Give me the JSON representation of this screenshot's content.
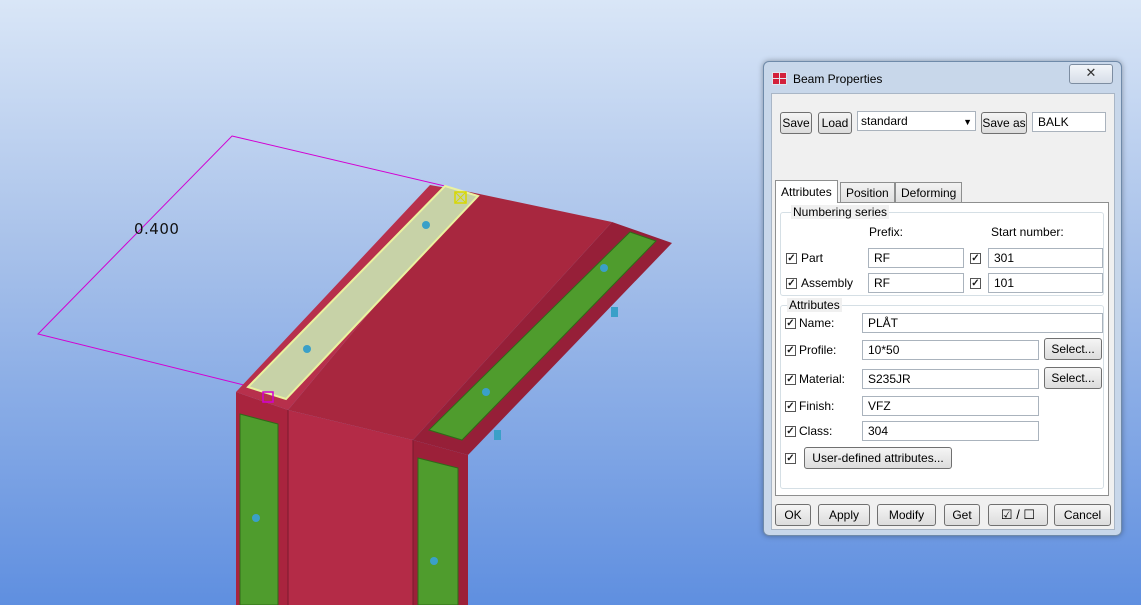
{
  "viewport": {
    "dimension_value": "0.400",
    "colors": {
      "beam": "#a52540",
      "plate": "#4e9a2c",
      "selected_plate": "#c8d6a2",
      "dimension_line": "#d200d2",
      "bolt": "#3aa0c8"
    }
  },
  "dialog": {
    "title": "Beam Properties",
    "close_icon": "close-icon",
    "toolbar": {
      "save_label": "Save",
      "load_label": "Load",
      "preset_value": "standard",
      "save_as_label": "Save as",
      "save_as_value": "BALK"
    },
    "tabs": [
      {
        "label": "Attributes",
        "active": true
      },
      {
        "label": "Position",
        "active": false
      },
      {
        "label": "Deforming",
        "active": false
      }
    ],
    "numbering": {
      "title": "Numbering series",
      "prefix_header": "Prefix:",
      "start_header": "Start number:",
      "rows": [
        {
          "label": "Part",
          "checked": true,
          "prefix": "RF",
          "start_checked": true,
          "start": "301"
        },
        {
          "label": "Assembly",
          "checked": true,
          "prefix": "RF",
          "start_checked": true,
          "start": "101"
        }
      ]
    },
    "attributes": {
      "title": "Attributes",
      "name": {
        "label": "Name:",
        "value": "PLÅT",
        "checked": true
      },
      "profile": {
        "label": "Profile:",
        "value": "10*50",
        "checked": true,
        "select_label": "Select..."
      },
      "material": {
        "label": "Material:",
        "value": "S235JR",
        "checked": true,
        "select_label": "Select..."
      },
      "finish": {
        "label": "Finish:",
        "value": "VFZ",
        "checked": true
      },
      "class": {
        "label": "Class:",
        "value": "304",
        "checked": true
      },
      "udf_label": "User-defined attributes..."
    },
    "footer": {
      "ok_label": "OK",
      "apply_label": "Apply",
      "modify_label": "Modify",
      "get_label": "Get",
      "toggle_label": "☑ / ☐",
      "cancel_label": "Cancel"
    }
  }
}
